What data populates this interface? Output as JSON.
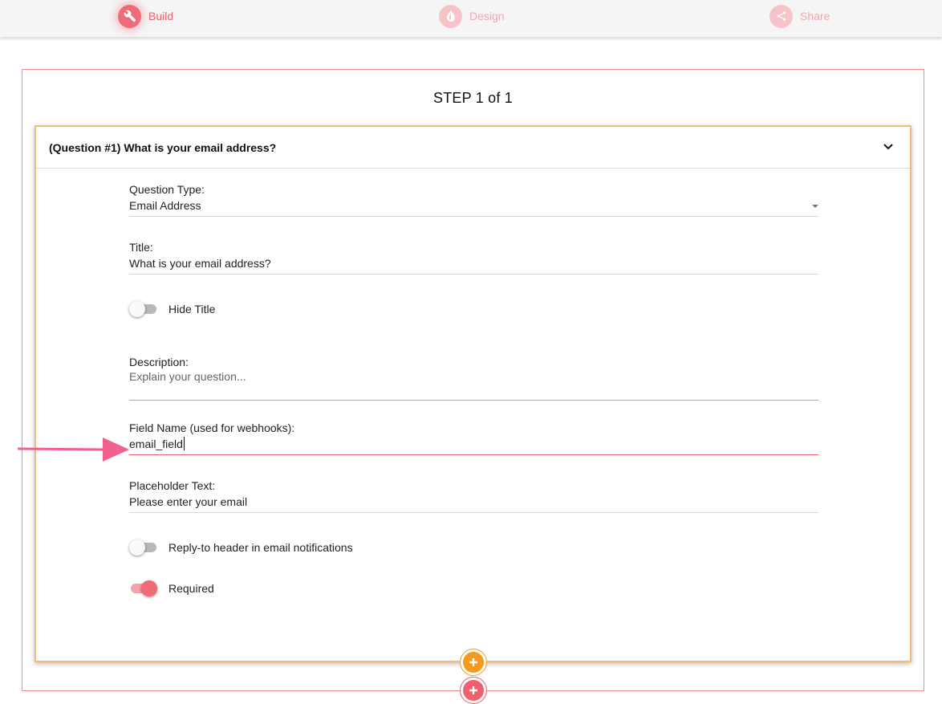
{
  "nav": {
    "items": [
      {
        "label": "Build",
        "icon": "wrench-icon",
        "active": true
      },
      {
        "label": "Design",
        "icon": "drop-icon",
        "active": false
      },
      {
        "label": "Share",
        "icon": "share-icon",
        "active": false
      }
    ]
  },
  "step": {
    "title": "STEP 1 of 1"
  },
  "question": {
    "header": "(Question #1) What is your email address?",
    "type_label": "Question Type:",
    "type_value": "Email Address",
    "title_label": "Title:",
    "title_value": "What is your email address?",
    "hide_title_label": "Hide Title",
    "hide_title_on": false,
    "description_label": "Description:",
    "description_placeholder": "Explain your question...",
    "field_name_label": "Field Name (used for webhooks):",
    "field_name_value": "email_field",
    "placeholder_label": "Placeholder Text:",
    "placeholder_value": "Please enter your email",
    "reply_to_label": "Reply-to header in email notifications",
    "reply_to_on": false,
    "required_label": "Required",
    "required_on": true
  },
  "colors": {
    "accent": "#ee5f6e",
    "accent_light": "#f6c3c8",
    "card_border": "#f7b97a",
    "add_question": "#f59a1c",
    "add_step": "#ef5f6d",
    "annotation_arrow": "#f0628d"
  },
  "icons": {
    "collapse": "chevron-down-icon",
    "add_question": "plus-circle-icon",
    "add_step": "plus-circle-icon"
  }
}
